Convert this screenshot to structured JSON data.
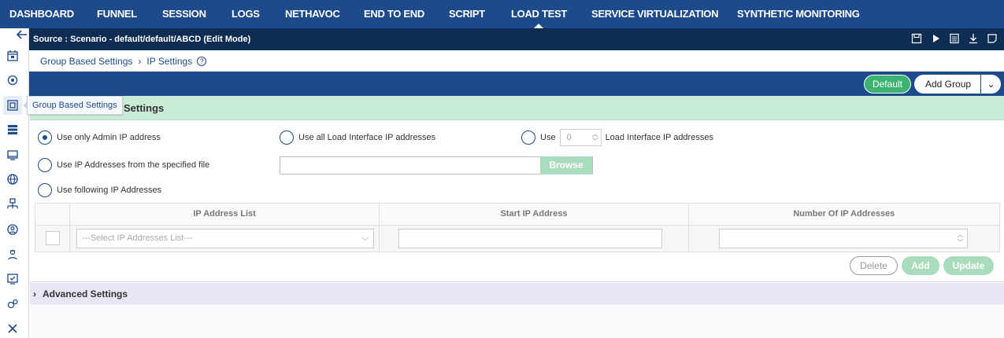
{
  "nav": {
    "tabs": [
      {
        "label": "DASHBOARD"
      },
      {
        "label": "FUNNEL"
      },
      {
        "label": "SESSION"
      },
      {
        "label": "LOGS"
      },
      {
        "label": "NETHAVOC"
      },
      {
        "label": "END TO END"
      },
      {
        "label": "SCRIPT"
      },
      {
        "label": "LOAD TEST",
        "active": true
      },
      {
        "label": "SERVICE VIRTUALIZATION"
      },
      {
        "label": "SYNTHETIC MONITORING"
      }
    ]
  },
  "sidebar": {
    "tooltip": "Group Based Settings",
    "icons": [
      "back-arrow-icon",
      "calendar-icon",
      "eye-settings-icon",
      "group-settings-icon",
      "server-list-icon",
      "monitor-icon",
      "globe-icon",
      "network-icon",
      "user-circle-icon",
      "worker-icon",
      "checklist-monitor-icon",
      "gears-icon",
      "tools-icon"
    ]
  },
  "source_bar": {
    "text": "Source : Scenario - default/default/ABCD (Edit Mode)",
    "tools": [
      "save-icon",
      "play-icon",
      "list-icon",
      "download-icon",
      "note-icon"
    ]
  },
  "breadcrumb": {
    "item1": "Group Based Settings",
    "item2": "IP Settings",
    "help": "?"
  },
  "actions": {
    "default_label": "Default",
    "add_group_label": "Add Group",
    "dropdown_glyph": "⌄"
  },
  "section": {
    "title": "Settings"
  },
  "options": {
    "admin_ip": "Use only Admin IP address",
    "all_load": "Use all Load Interface IP addresses",
    "use_label": "Use",
    "use_count": "0",
    "use_suffix": "Load Interface IP addresses",
    "from_file": "Use IP Addresses from the specified file",
    "following": "Use following IP Addresses",
    "selected": "admin_ip"
  },
  "file": {
    "browse_label": "Browse"
  },
  "table": {
    "columns": [
      "IP Address List",
      "Start IP Address",
      "Number Of IP Addresses"
    ],
    "select_placeholder": "---Select IP Addresses List---"
  },
  "table_buttons": {
    "delete": "Delete",
    "add": "Add",
    "update": "Update"
  },
  "advanced": {
    "label": "Advanced Settings",
    "chevron": "›"
  },
  "colors": {
    "nav_bg": "#1d4a8a",
    "source_bg": "#0f2c52",
    "section_bg": "#c9ecd6",
    "accent_green": "#3cb371",
    "advanced_bg": "#e8e6f6"
  }
}
